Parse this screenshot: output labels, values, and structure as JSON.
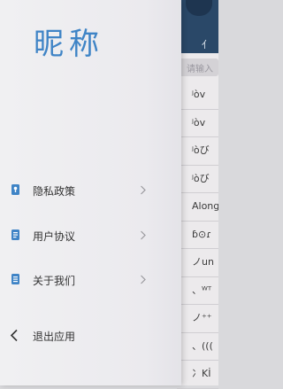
{
  "drawer": {
    "title": "昵称",
    "menu": [
      {
        "label": "隐私政策",
        "icon": "privacy-icon"
      },
      {
        "label": "用户协议",
        "icon": "document-icon"
      },
      {
        "label": "关于我们",
        "icon": "info-document-icon"
      }
    ],
    "exit_label": "退出应用"
  },
  "background": {
    "header_text": "亻",
    "search_placeholder": "请输入",
    "rows": [
      "ʲòv",
      "ʲòv",
      "ʲòび",
      "ʲòび",
      "Along",
      "ɓ⊙ɾ",
      "ノun",
      "、ᵂᵀ",
      "ノ⁺⁺",
      "、(((",
      "冫Kİ"
    ]
  },
  "colors": {
    "accent": "#3f84c6",
    "header": "#2a4868"
  }
}
